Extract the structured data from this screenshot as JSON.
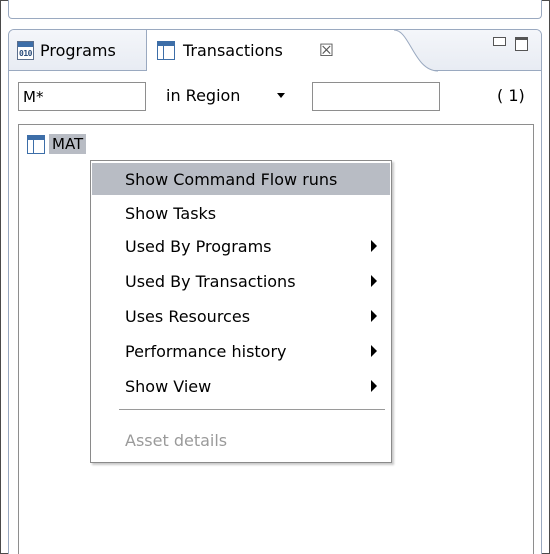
{
  "tabs": {
    "programs_label": "Programs",
    "programs_icon_bits": "010",
    "transactions_label": "Transactions",
    "close_glyph": "☒"
  },
  "filter": {
    "name_value": "M*",
    "region_label": "in Region",
    "region_value": "",
    "count": "( 1)"
  },
  "tree": {
    "items": [
      {
        "label": "MAT"
      }
    ]
  },
  "context_menu": {
    "items": [
      {
        "label": "Show Command Flow runs",
        "selected": true,
        "submenu": false,
        "enabled": true
      },
      {
        "label": "Show Tasks",
        "selected": false,
        "submenu": false,
        "enabled": true
      },
      {
        "label": "Used By Programs",
        "selected": false,
        "submenu": true,
        "enabled": true
      },
      {
        "label": "Used By Transactions",
        "selected": false,
        "submenu": true,
        "enabled": true
      },
      {
        "label": "Uses Resources",
        "selected": false,
        "submenu": true,
        "enabled": true
      },
      {
        "label": "Performance history",
        "selected": false,
        "submenu": true,
        "enabled": true
      },
      {
        "label": "Show View",
        "selected": false,
        "submenu": true,
        "enabled": true
      },
      {
        "label": "Asset details",
        "selected": false,
        "submenu": false,
        "enabled": false
      }
    ]
  },
  "colors": {
    "selection": "#b8bcc4",
    "border": "#9aa9c0",
    "icon_blue": "#3d6ea8",
    "disabled_text": "#9a9a9a"
  }
}
